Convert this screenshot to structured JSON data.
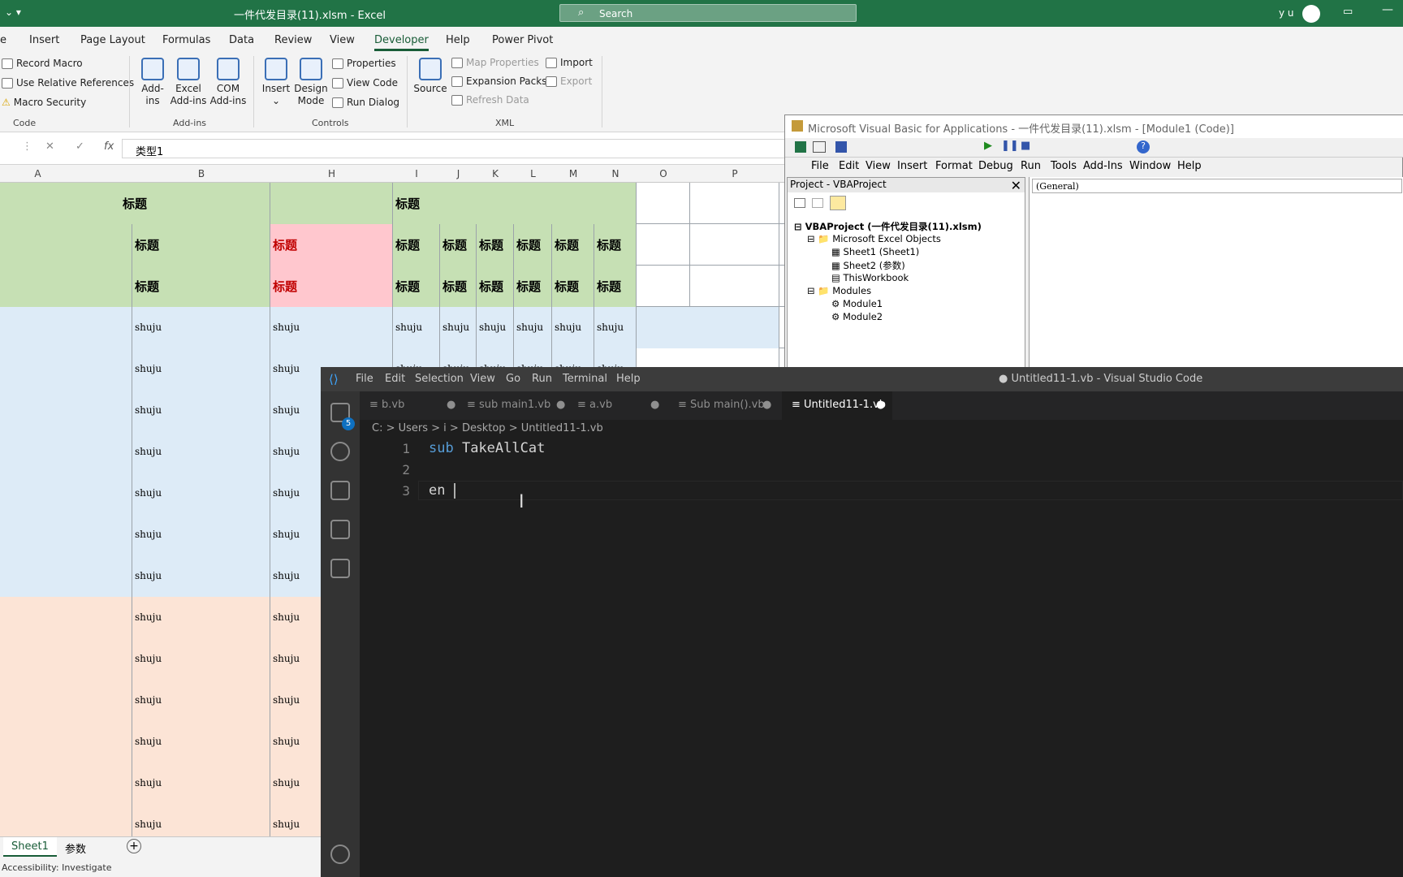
{
  "excel": {
    "title": "一件代发目录(11).xlsm  -  Excel",
    "search_placeholder": "Search",
    "user": "y u",
    "tabs": [
      "e",
      "Insert",
      "Page Layout",
      "Formulas",
      "Data",
      "Review",
      "View",
      "Developer",
      "Help",
      "Power Pivot"
    ],
    "ribbon": {
      "code": {
        "record_macro": "Record Macro",
        "relative": "Use Relative References",
        "security": "Macro Security",
        "group": "Code"
      },
      "addins": {
        "addins": "Add-\nins",
        "excel_addins": "Excel\nAdd-ins",
        "com_addins": "COM\nAdd-ins",
        "group": "Add-ins"
      },
      "controls": {
        "insert": "Insert",
        "design_mode": "Design\nMode",
        "properties": "Properties",
        "view_code": "View Code",
        "run_dialog": "Run Dialog",
        "group": "Controls"
      },
      "xml": {
        "source": "Source",
        "map_properties": "Map Properties",
        "expansion_packs": "Expansion Packs",
        "refresh_data": "Refresh Data",
        "import": "Import",
        "export": "Export",
        "group": "XML"
      }
    },
    "formula_value": "类型1",
    "fx": "fx",
    "columns": [
      "A",
      "B",
      "H",
      "I",
      "J",
      "K",
      "L",
      "M",
      "N",
      "O",
      "P"
    ],
    "header_text": "标题",
    "data_text": "shuju",
    "sheets": [
      "Sheet1",
      "参数"
    ],
    "status": "Accessibility: Investigate",
    "colors": {
      "green": "#c6e0b4",
      "pink": "#ffc7ce",
      "blue": "#ddebf7",
      "peach": "#fce4d6"
    }
  },
  "vba": {
    "title": "Microsoft Visual Basic for Applications - 一件代发目录(11).xlsm - [Module1 (Code)]",
    "menu": [
      "File",
      "Edit",
      "View",
      "Insert",
      "Format",
      "Debug",
      "Run",
      "Tools",
      "Add-Ins",
      "Window",
      "Help"
    ],
    "project_header": "Project - VBAProject",
    "tree": {
      "root": "VBAProject (一件代发目录(11).xlsm)",
      "excel_objects": "Microsoft Excel Objects",
      "sheet1": "Sheet1 (Sheet1)",
      "sheet2": "Sheet2 (参数)",
      "workbook": "ThisWorkbook",
      "modules": "Modules",
      "module1": "Module1",
      "module2": "Module2"
    },
    "general": "(General)"
  },
  "vscode": {
    "menu": [
      "File",
      "Edit",
      "Selection",
      "View",
      "Go",
      "Run",
      "Terminal",
      "Help"
    ],
    "title": "● Untitled11-1.vb - Visual Studio Code",
    "tabs": [
      "b.vb",
      "sub main1.vb",
      "a.vb",
      "Sub main().vb",
      "Untitled11-1.vb"
    ],
    "breadcrumb": "C: > Users > i > Desktop > Untitled11-1.vb",
    "line_numbers": [
      "1",
      "2",
      "3"
    ],
    "code": {
      "kw": "sub",
      "name": "TakeAllCat",
      "line3": "en "
    },
    "badge": "5"
  }
}
